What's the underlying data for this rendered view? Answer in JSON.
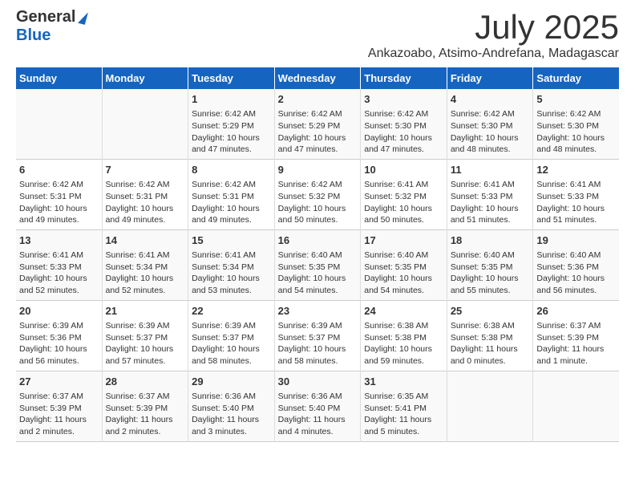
{
  "header": {
    "logo_general": "General",
    "logo_blue": "Blue",
    "month_title": "July 2025",
    "location": "Ankazoabo, Atsimo-Andrefana, Madagascar"
  },
  "days_of_week": [
    "Sunday",
    "Monday",
    "Tuesday",
    "Wednesday",
    "Thursday",
    "Friday",
    "Saturday"
  ],
  "weeks": [
    [
      {
        "day": "",
        "detail": ""
      },
      {
        "day": "",
        "detail": ""
      },
      {
        "day": "1",
        "detail": "Sunrise: 6:42 AM\nSunset: 5:29 PM\nDaylight: 10 hours\nand 47 minutes."
      },
      {
        "day": "2",
        "detail": "Sunrise: 6:42 AM\nSunset: 5:29 PM\nDaylight: 10 hours\nand 47 minutes."
      },
      {
        "day": "3",
        "detail": "Sunrise: 6:42 AM\nSunset: 5:30 PM\nDaylight: 10 hours\nand 47 minutes."
      },
      {
        "day": "4",
        "detail": "Sunrise: 6:42 AM\nSunset: 5:30 PM\nDaylight: 10 hours\nand 48 minutes."
      },
      {
        "day": "5",
        "detail": "Sunrise: 6:42 AM\nSunset: 5:30 PM\nDaylight: 10 hours\nand 48 minutes."
      }
    ],
    [
      {
        "day": "6",
        "detail": "Sunrise: 6:42 AM\nSunset: 5:31 PM\nDaylight: 10 hours\nand 49 minutes."
      },
      {
        "day": "7",
        "detail": "Sunrise: 6:42 AM\nSunset: 5:31 PM\nDaylight: 10 hours\nand 49 minutes."
      },
      {
        "day": "8",
        "detail": "Sunrise: 6:42 AM\nSunset: 5:31 PM\nDaylight: 10 hours\nand 49 minutes."
      },
      {
        "day": "9",
        "detail": "Sunrise: 6:42 AM\nSunset: 5:32 PM\nDaylight: 10 hours\nand 50 minutes."
      },
      {
        "day": "10",
        "detail": "Sunrise: 6:41 AM\nSunset: 5:32 PM\nDaylight: 10 hours\nand 50 minutes."
      },
      {
        "day": "11",
        "detail": "Sunrise: 6:41 AM\nSunset: 5:33 PM\nDaylight: 10 hours\nand 51 minutes."
      },
      {
        "day": "12",
        "detail": "Sunrise: 6:41 AM\nSunset: 5:33 PM\nDaylight: 10 hours\nand 51 minutes."
      }
    ],
    [
      {
        "day": "13",
        "detail": "Sunrise: 6:41 AM\nSunset: 5:33 PM\nDaylight: 10 hours\nand 52 minutes."
      },
      {
        "day": "14",
        "detail": "Sunrise: 6:41 AM\nSunset: 5:34 PM\nDaylight: 10 hours\nand 52 minutes."
      },
      {
        "day": "15",
        "detail": "Sunrise: 6:41 AM\nSunset: 5:34 PM\nDaylight: 10 hours\nand 53 minutes."
      },
      {
        "day": "16",
        "detail": "Sunrise: 6:40 AM\nSunset: 5:35 PM\nDaylight: 10 hours\nand 54 minutes."
      },
      {
        "day": "17",
        "detail": "Sunrise: 6:40 AM\nSunset: 5:35 PM\nDaylight: 10 hours\nand 54 minutes."
      },
      {
        "day": "18",
        "detail": "Sunrise: 6:40 AM\nSunset: 5:35 PM\nDaylight: 10 hours\nand 55 minutes."
      },
      {
        "day": "19",
        "detail": "Sunrise: 6:40 AM\nSunset: 5:36 PM\nDaylight: 10 hours\nand 56 minutes."
      }
    ],
    [
      {
        "day": "20",
        "detail": "Sunrise: 6:39 AM\nSunset: 5:36 PM\nDaylight: 10 hours\nand 56 minutes."
      },
      {
        "day": "21",
        "detail": "Sunrise: 6:39 AM\nSunset: 5:37 PM\nDaylight: 10 hours\nand 57 minutes."
      },
      {
        "day": "22",
        "detail": "Sunrise: 6:39 AM\nSunset: 5:37 PM\nDaylight: 10 hours\nand 58 minutes."
      },
      {
        "day": "23",
        "detail": "Sunrise: 6:39 AM\nSunset: 5:37 PM\nDaylight: 10 hours\nand 58 minutes."
      },
      {
        "day": "24",
        "detail": "Sunrise: 6:38 AM\nSunset: 5:38 PM\nDaylight: 10 hours\nand 59 minutes."
      },
      {
        "day": "25",
        "detail": "Sunrise: 6:38 AM\nSunset: 5:38 PM\nDaylight: 11 hours\nand 0 minutes."
      },
      {
        "day": "26",
        "detail": "Sunrise: 6:37 AM\nSunset: 5:39 PM\nDaylight: 11 hours\nand 1 minute."
      }
    ],
    [
      {
        "day": "27",
        "detail": "Sunrise: 6:37 AM\nSunset: 5:39 PM\nDaylight: 11 hours\nand 2 minutes."
      },
      {
        "day": "28",
        "detail": "Sunrise: 6:37 AM\nSunset: 5:39 PM\nDaylight: 11 hours\nand 2 minutes."
      },
      {
        "day": "29",
        "detail": "Sunrise: 6:36 AM\nSunset: 5:40 PM\nDaylight: 11 hours\nand 3 minutes."
      },
      {
        "day": "30",
        "detail": "Sunrise: 6:36 AM\nSunset: 5:40 PM\nDaylight: 11 hours\nand 4 minutes."
      },
      {
        "day": "31",
        "detail": "Sunrise: 6:35 AM\nSunset: 5:41 PM\nDaylight: 11 hours\nand 5 minutes."
      },
      {
        "day": "",
        "detail": ""
      },
      {
        "day": "",
        "detail": ""
      }
    ]
  ]
}
